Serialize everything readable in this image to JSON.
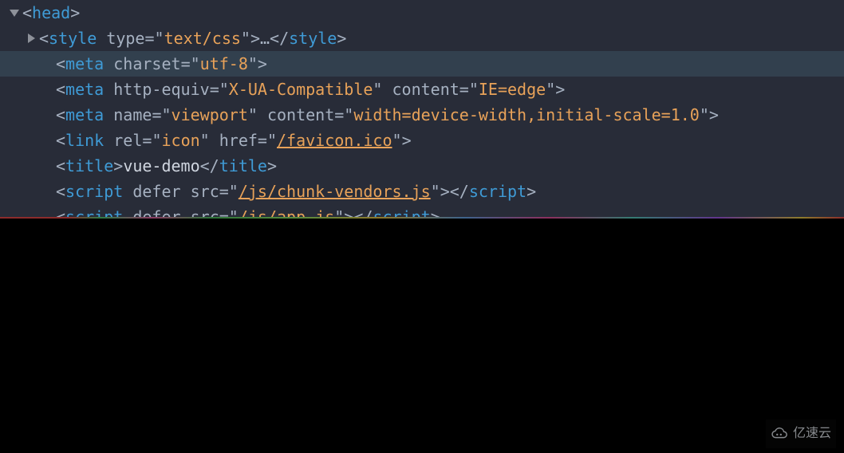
{
  "dom": {
    "head": {
      "tag": "head",
      "style": {
        "tag": "style",
        "type_attr": "type",
        "type_val": "text/css",
        "ellipsis": "…"
      },
      "meta_charset": {
        "tag": "meta",
        "charset_attr": "charset",
        "charset_val": "utf-8"
      },
      "meta_compat": {
        "tag": "meta",
        "equiv_attr": "http-equiv",
        "equiv_val": "X-UA-Compatible",
        "content_attr": "content",
        "content_val": "IE=edge"
      },
      "meta_viewport": {
        "tag": "meta",
        "name_attr": "name",
        "name_val": "viewport",
        "content_attr": "content",
        "content_val": "width=device-width,initial-scale=1.0"
      },
      "link_icon": {
        "tag": "link",
        "rel_attr": "rel",
        "rel_val": "icon",
        "href_attr": "href",
        "href_val": "/favicon.ico"
      },
      "title": {
        "tag": "title",
        "text": "vue-demo"
      },
      "script_vendors": {
        "tag": "script",
        "defer_attr": "defer",
        "src_attr": "src",
        "src_val": "/js/chunk-vendors.js"
      },
      "script_app": {
        "tag": "script",
        "defer_attr": "defer",
        "src_attr": "src",
        "src_val": "/js/app.js"
      }
    }
  },
  "watermark": {
    "text": "亿速云"
  }
}
